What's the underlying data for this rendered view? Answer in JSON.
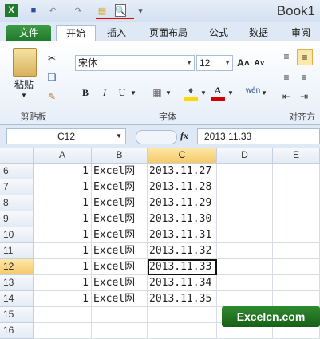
{
  "title": "Book1",
  "ribbon_tabs": [
    "文件",
    "开始",
    "插入",
    "页面布局",
    "公式",
    "数据",
    "审阅"
  ],
  "clipboard": {
    "paste_label": "粘贴",
    "group_label": "剪贴板"
  },
  "font": {
    "name": "宋体",
    "size": "12",
    "group_label": "字体",
    "bold": "B",
    "italic": "I",
    "underline": "U"
  },
  "alignment": {
    "group_label": "对齐方"
  },
  "formula_bar": {
    "name_box": "C12",
    "fx": "fx",
    "value": "2013.11.33"
  },
  "columns": [
    "A",
    "B",
    "C",
    "D",
    "E"
  ],
  "selected_column": "C",
  "selected_row": "12",
  "rows": [
    {
      "n": "6",
      "a": "1",
      "b": "Excel网",
      "c": "2013.11.27"
    },
    {
      "n": "7",
      "a": "1",
      "b": "Excel网",
      "c": "2013.11.28"
    },
    {
      "n": "8",
      "a": "1",
      "b": "Excel网",
      "c": "2013.11.29"
    },
    {
      "n": "9",
      "a": "1",
      "b": "Excel网",
      "c": "2013.11.30"
    },
    {
      "n": "10",
      "a": "1",
      "b": "Excel网",
      "c": "2013.11.31"
    },
    {
      "n": "11",
      "a": "1",
      "b": "Excel网",
      "c": "2013.11.32"
    },
    {
      "n": "12",
      "a": "1",
      "b": "Excel网",
      "c": "2013.11.33"
    },
    {
      "n": "13",
      "a": "1",
      "b": "Excel网",
      "c": "2013.11.34"
    },
    {
      "n": "14",
      "a": "1",
      "b": "Excel网",
      "c": "2013.11.35"
    },
    {
      "n": "15",
      "a": "",
      "b": "",
      "c": ""
    },
    {
      "n": "16",
      "a": "",
      "b": "",
      "c": ""
    }
  ],
  "watermark": "Excelcn.com",
  "colors": {
    "file_tab": "#1f7a2b",
    "selected_header": "#f6c96a",
    "font_color": "#d00000",
    "highlight": "#ffd800"
  }
}
